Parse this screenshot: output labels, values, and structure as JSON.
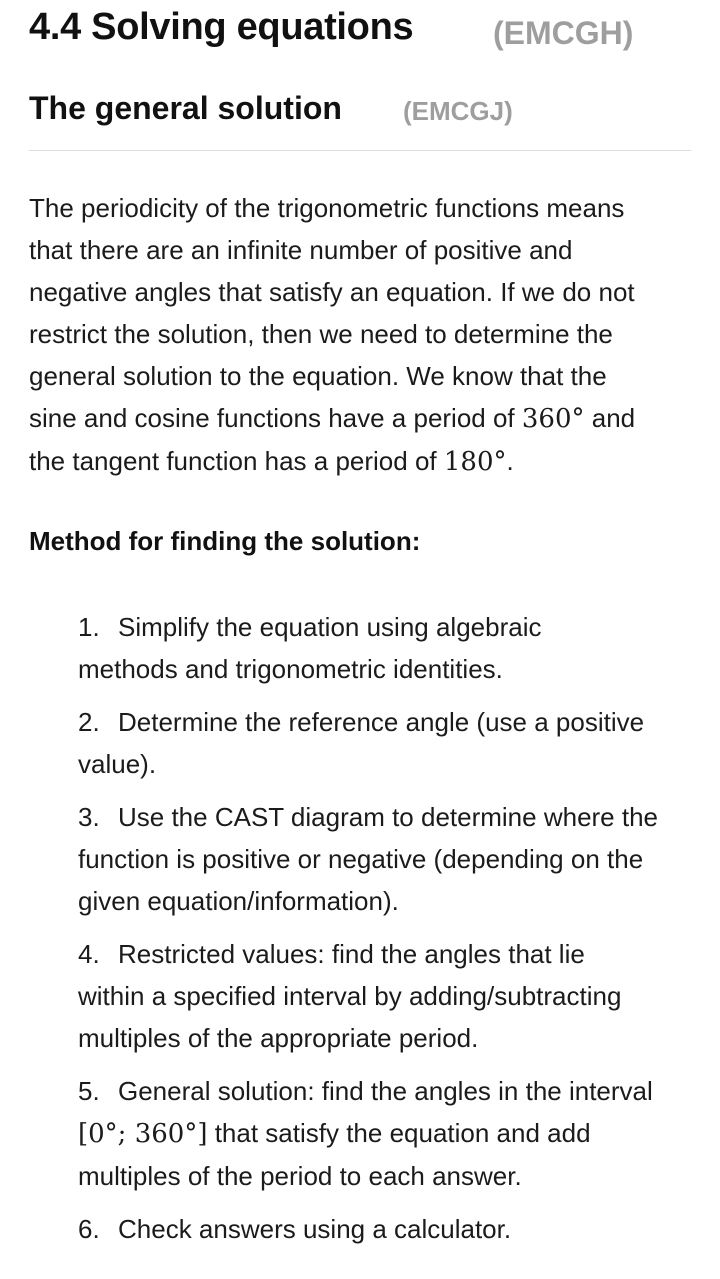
{
  "section": {
    "title": "4.4 Solving equations",
    "code": "(EMCGH)"
  },
  "subsection": {
    "title": "The general solution",
    "code": "(EMCGJ)"
  },
  "paragraph": {
    "line1": "The periodicity of the trigonometric functions means",
    "line2": "that there are an infinite number of positive and",
    "line3": "negative angles that satisfy an equation. If we do not",
    "line4": "restrict the solution, then we need to determine the",
    "line5": "general solution to the equation. We know that the",
    "line6_pre": "sine and cosine functions have a period of ",
    "line6_math": "360°",
    "line6_post": " and",
    "line7_pre": "the tangent function has a period of ",
    "line7_math": "180°",
    "line7_post": "."
  },
  "method": {
    "heading": "Method for finding the solution:",
    "steps": [
      {
        "num": "1.",
        "line1": "Simplify the equation using algebraic",
        "line2": "methods and trigonometric identities."
      },
      {
        "num": "2.",
        "line1": "Determine the reference angle (use a positive",
        "line2": "value)."
      },
      {
        "num": "3.",
        "line1": "Use the CAST diagram to determine where the",
        "line2": "function is positive or negative (depending on the",
        "line3": "given equation/information)."
      },
      {
        "num": "4.",
        "line1": "Restricted values: find the angles that lie",
        "line2": "within a specified interval by adding/subtracting",
        "line3": "multiples of the appropriate period."
      },
      {
        "num": "5.",
        "line1": "General solution: find the angles in the interval",
        "line2_math": "[0°; 360°]",
        "line2_post": " that satisfy the equation and add",
        "line3": "multiples of the period to each answer."
      },
      {
        "num": "6.",
        "line1": "Check answers using a calculator."
      }
    ]
  }
}
